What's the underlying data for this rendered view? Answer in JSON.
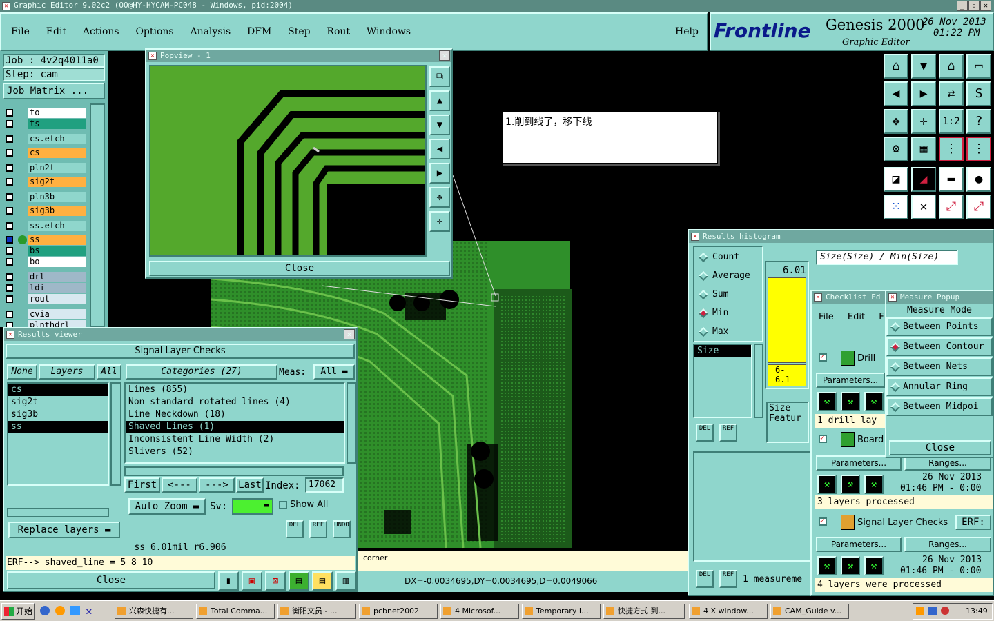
{
  "window": {
    "title": "Graphic Editor 9.02c2  (OO@HY-HYCAM-PC048 - Windows, pid:2004)"
  },
  "menubar": {
    "items": [
      "File",
      "Edit",
      "Actions",
      "Options",
      "Analysis",
      "DFM",
      "Step",
      "Rout",
      "Windows"
    ],
    "help": "Help"
  },
  "branding": {
    "logo": "Frontline",
    "product": "Genesis 2000",
    "subtitle": "Graphic Editor",
    "date": "26 Nov 2013",
    "time": "01:22 PM"
  },
  "job": {
    "job_label": "Job : 4v2q4011a0",
    "step_label": "Step: cam",
    "matrix_button": "Job Matrix ..."
  },
  "layers": [
    {
      "name": "to",
      "color": "#ffffff"
    },
    {
      "name": "ts",
      "color": "#20a080"
    },
    {
      "name": "cs.etch",
      "color": "#8fd6cc"
    },
    {
      "name": "cs",
      "color": "#ffb040"
    },
    {
      "name": "pln2t",
      "color": "#8fd6cc"
    },
    {
      "name": "sig2t",
      "color": "#ffb040"
    },
    {
      "name": "pln3b",
      "color": "#8fd6cc"
    },
    {
      "name": "sig3b",
      "color": "#ffb040"
    },
    {
      "name": "ss.etch",
      "color": "#8fd6cc"
    },
    {
      "name": "ss",
      "color": "#ffb040"
    },
    {
      "name": "bs",
      "color": "#20a080"
    },
    {
      "name": "bo",
      "color": "#ffffff"
    },
    {
      "name": "drl",
      "color": "#9fb8c8"
    },
    {
      "name": "ldi",
      "color": "#9fb8c8"
    },
    {
      "name": "rout",
      "color": "#d8e8f0"
    },
    {
      "name": "cvia",
      "color": "#d8e8f0"
    },
    {
      "name": "plnthdrl",
      "color": "#d8e8f0"
    }
  ],
  "popview": {
    "title": "Popview - 1",
    "close": "Close"
  },
  "annotation": {
    "text": "1.削到线了，移下线"
  },
  "results_viewer": {
    "title": "Results viewer",
    "header": "Signal Layer Checks",
    "none_btn": "None",
    "layers_btn": "Layers",
    "all_btn": "All",
    "categories_btn": "Categories (27)",
    "meas_label": "Meas:",
    "meas_value": "All",
    "layers_list": [
      "cs",
      "sig2t",
      "sig3b",
      "ss"
    ],
    "categories": [
      "Lines (855)",
      "Non standard rotated lines (4)",
      "Line Neckdown (18)",
      "Shaved Lines (1)",
      "Inconsistent Line Width (2)",
      "Slivers (52)"
    ],
    "first": "First",
    "prev": "<---",
    "next": "--->",
    "last": "Last",
    "index_label": "Index:",
    "index_value": "17062",
    "auto_zoom": "Auto Zoom",
    "sv_label": "Sv:",
    "show_all": "Show All",
    "replace_layers": "Replace layers",
    "status": "ss 6.01mil  r6.906",
    "erf": "ERF--> shaved_line = 5 8 10",
    "close": "Close"
  },
  "status_bar": {
    "message": "corner",
    "coords": "DX=-0.0034695,DY=0.0034695,D=0.0049066"
  },
  "histogram": {
    "title": "Results histogram",
    "options": [
      "Count",
      "Average",
      "Sum",
      "Min",
      "Max"
    ],
    "selected": "Min",
    "header": "Size(Size) / Min(Size)",
    "value_top": "6.01",
    "bar_label": "6-\n6.1",
    "size_item": "Size",
    "size_label": "Size",
    "feature_label": "Featur",
    "measure_count": "1 measureme"
  },
  "checklist": {
    "title": "Checklist Ed",
    "menu": [
      "File",
      "Edit",
      "F"
    ],
    "items": [
      {
        "name": "Drill",
        "params": "Parameters...",
        "info": "1 drill lay"
      },
      {
        "name": "Board",
        "params": "Parameters...",
        "ranges": "Ranges...",
        "date": "26 Nov 2013",
        "time": "01:46 PM - 0:00",
        "info": "3 layers processed"
      },
      {
        "name": "Signal Layer Checks",
        "erf": "ERF:",
        "params": "Parameters...",
        "ranges": "Ranges...",
        "date": "26 Nov 2013",
        "time": "01:46 PM - 0:00",
        "info": "4 layers were processed"
      }
    ]
  },
  "measure_popup": {
    "title": "Measure Popup",
    "mode_label": "Measure Mode",
    "options": [
      "Between Points",
      "Between Contour",
      "Between Nets",
      "Annular Ring",
      "Between Midpoi"
    ],
    "selected": "Between Contour",
    "close": "Close"
  },
  "taskbar": {
    "start": "开始",
    "buttons": [
      "兴森快捷有...",
      "Total Comma...",
      "衡阳文员 - ...",
      "pcbnet2002",
      "4 Microsof...",
      "Temporary I...",
      "快捷方式 到...",
      "4 X window...",
      "CAM_Guide v..."
    ],
    "clock": "13:49"
  },
  "colors": {
    "teal": "#8fd6cc",
    "pcb_green": "#2f8f2a",
    "popview_green": "#54a82c",
    "highlight_yellow": "#ffff00"
  }
}
